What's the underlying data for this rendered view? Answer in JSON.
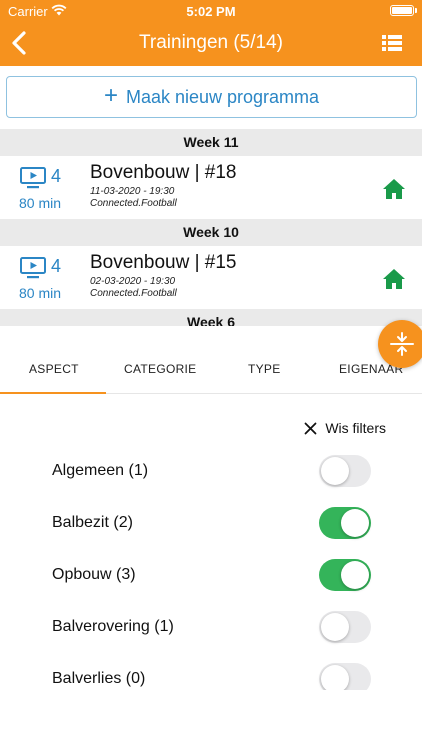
{
  "status_bar": {
    "carrier": "Carrier",
    "time": "5:02 PM"
  },
  "nav": {
    "title": "Trainingen (5/14)",
    "back_icon": "chevron-left-icon",
    "list_icon": "list-view-icon"
  },
  "new_program": {
    "label": "Maak nieuw programma",
    "icon": "plus-icon"
  },
  "weeks": [
    {
      "label": "Week 11",
      "session": {
        "count": "4",
        "duration": "80 min",
        "title": "Bovenbouw | #18",
        "datetime": "11-03-2020 - 19:30",
        "owner": "Connected.Football",
        "location_icon": "home-icon"
      }
    },
    {
      "label": "Week 10",
      "session": {
        "count": "4",
        "duration": "80 min",
        "title": "Bovenbouw | #15",
        "datetime": "02-03-2020 - 19:30",
        "owner": "Connected.Football",
        "location_icon": "home-icon"
      }
    },
    {
      "label": "Week 6"
    }
  ],
  "filter_tabs": [
    {
      "label": "ASPECT",
      "active": true
    },
    {
      "label": "CATEGORIE",
      "active": false
    },
    {
      "label": "TYPE",
      "active": false
    },
    {
      "label": "EIGENAAR",
      "active": false
    }
  ],
  "clear_filters": {
    "label": "Wis filters"
  },
  "filters": [
    {
      "label": "Algemeen (1)",
      "on": false
    },
    {
      "label": "Balbezit (2)",
      "on": true
    },
    {
      "label": "Opbouw (3)",
      "on": true
    },
    {
      "label": "Balverovering (1)",
      "on": false
    },
    {
      "label": "Balverlies (0)",
      "on": false
    }
  ],
  "colors": {
    "accent": "#f6921e",
    "link_blue": "#2b86c5",
    "toggle_on": "#34b45a",
    "home_green": "#1a9a4a"
  }
}
